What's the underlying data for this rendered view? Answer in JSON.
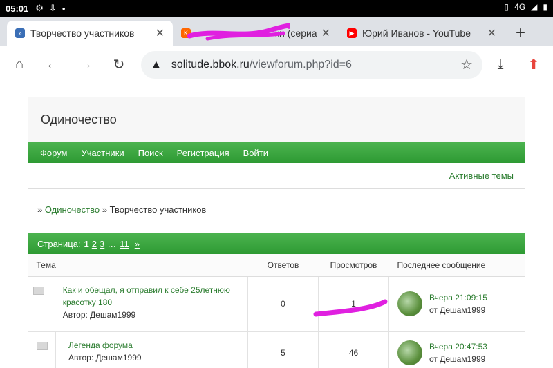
{
  "status_bar": {
    "time": "05:01",
    "icons": [
      "gear-icon",
      "download-icon",
      "dot-icon"
    ],
    "right_icons": [
      "vibrate-icon",
      "signal-icon",
      "battery-icon"
    ],
    "network": "4G"
  },
  "tabs": [
    {
      "title": "Творчество участников",
      "favicon": "forum-icon",
      "favicon_color": "#3b6fb6",
      "active": true
    },
    {
      "title": "ки (сериа",
      "favicon": "kinopoisk-icon",
      "favicon_color": "#f60",
      "active": false
    },
    {
      "title": "Юрий Иванов - YouTube",
      "favicon": "youtube-icon",
      "favicon_color": "#ff0000",
      "active": false
    }
  ],
  "toolbar": {
    "url_host": "solitude.bbok.ru",
    "url_path": "/viewforum.php?id=6"
  },
  "forum": {
    "board_title": "Одиночество",
    "nav": [
      "Форум",
      "Участники",
      "Поиск",
      "Регистрация",
      "Войти"
    ],
    "active_topics": "Активные темы",
    "breadcrumb": {
      "sep": "»",
      "home": "Одиночество",
      "current": "Творчество участников"
    },
    "pagination": {
      "label": "Страница:",
      "current": "1",
      "pages": [
        "2",
        "3"
      ],
      "ellipsis": "…",
      "last": "11",
      "next": "»"
    },
    "columns": {
      "topic": "Тема",
      "replies": "Ответов",
      "views": "Просмотров",
      "last_post": "Последнее сообщение"
    },
    "topics": [
      {
        "title": "Как и обещал, я отправил к себе 25летнюю красотку 180",
        "author": "Автор: Дешам1999",
        "replies": "0",
        "views": "1",
        "last_when": "Вчера 21:09:15",
        "last_by": "от Дешам1999"
      },
      {
        "title": "Легенда форума",
        "author": "Автор: Дешам1999",
        "replies": "5",
        "views": "46",
        "last_when": "Вчера 20:47:53",
        "last_by": "от Дешам1999"
      }
    ]
  },
  "colors": {
    "accent_green": "#2e9a33",
    "link_green": "#2a7c2e",
    "scribble": "#e020e0"
  }
}
